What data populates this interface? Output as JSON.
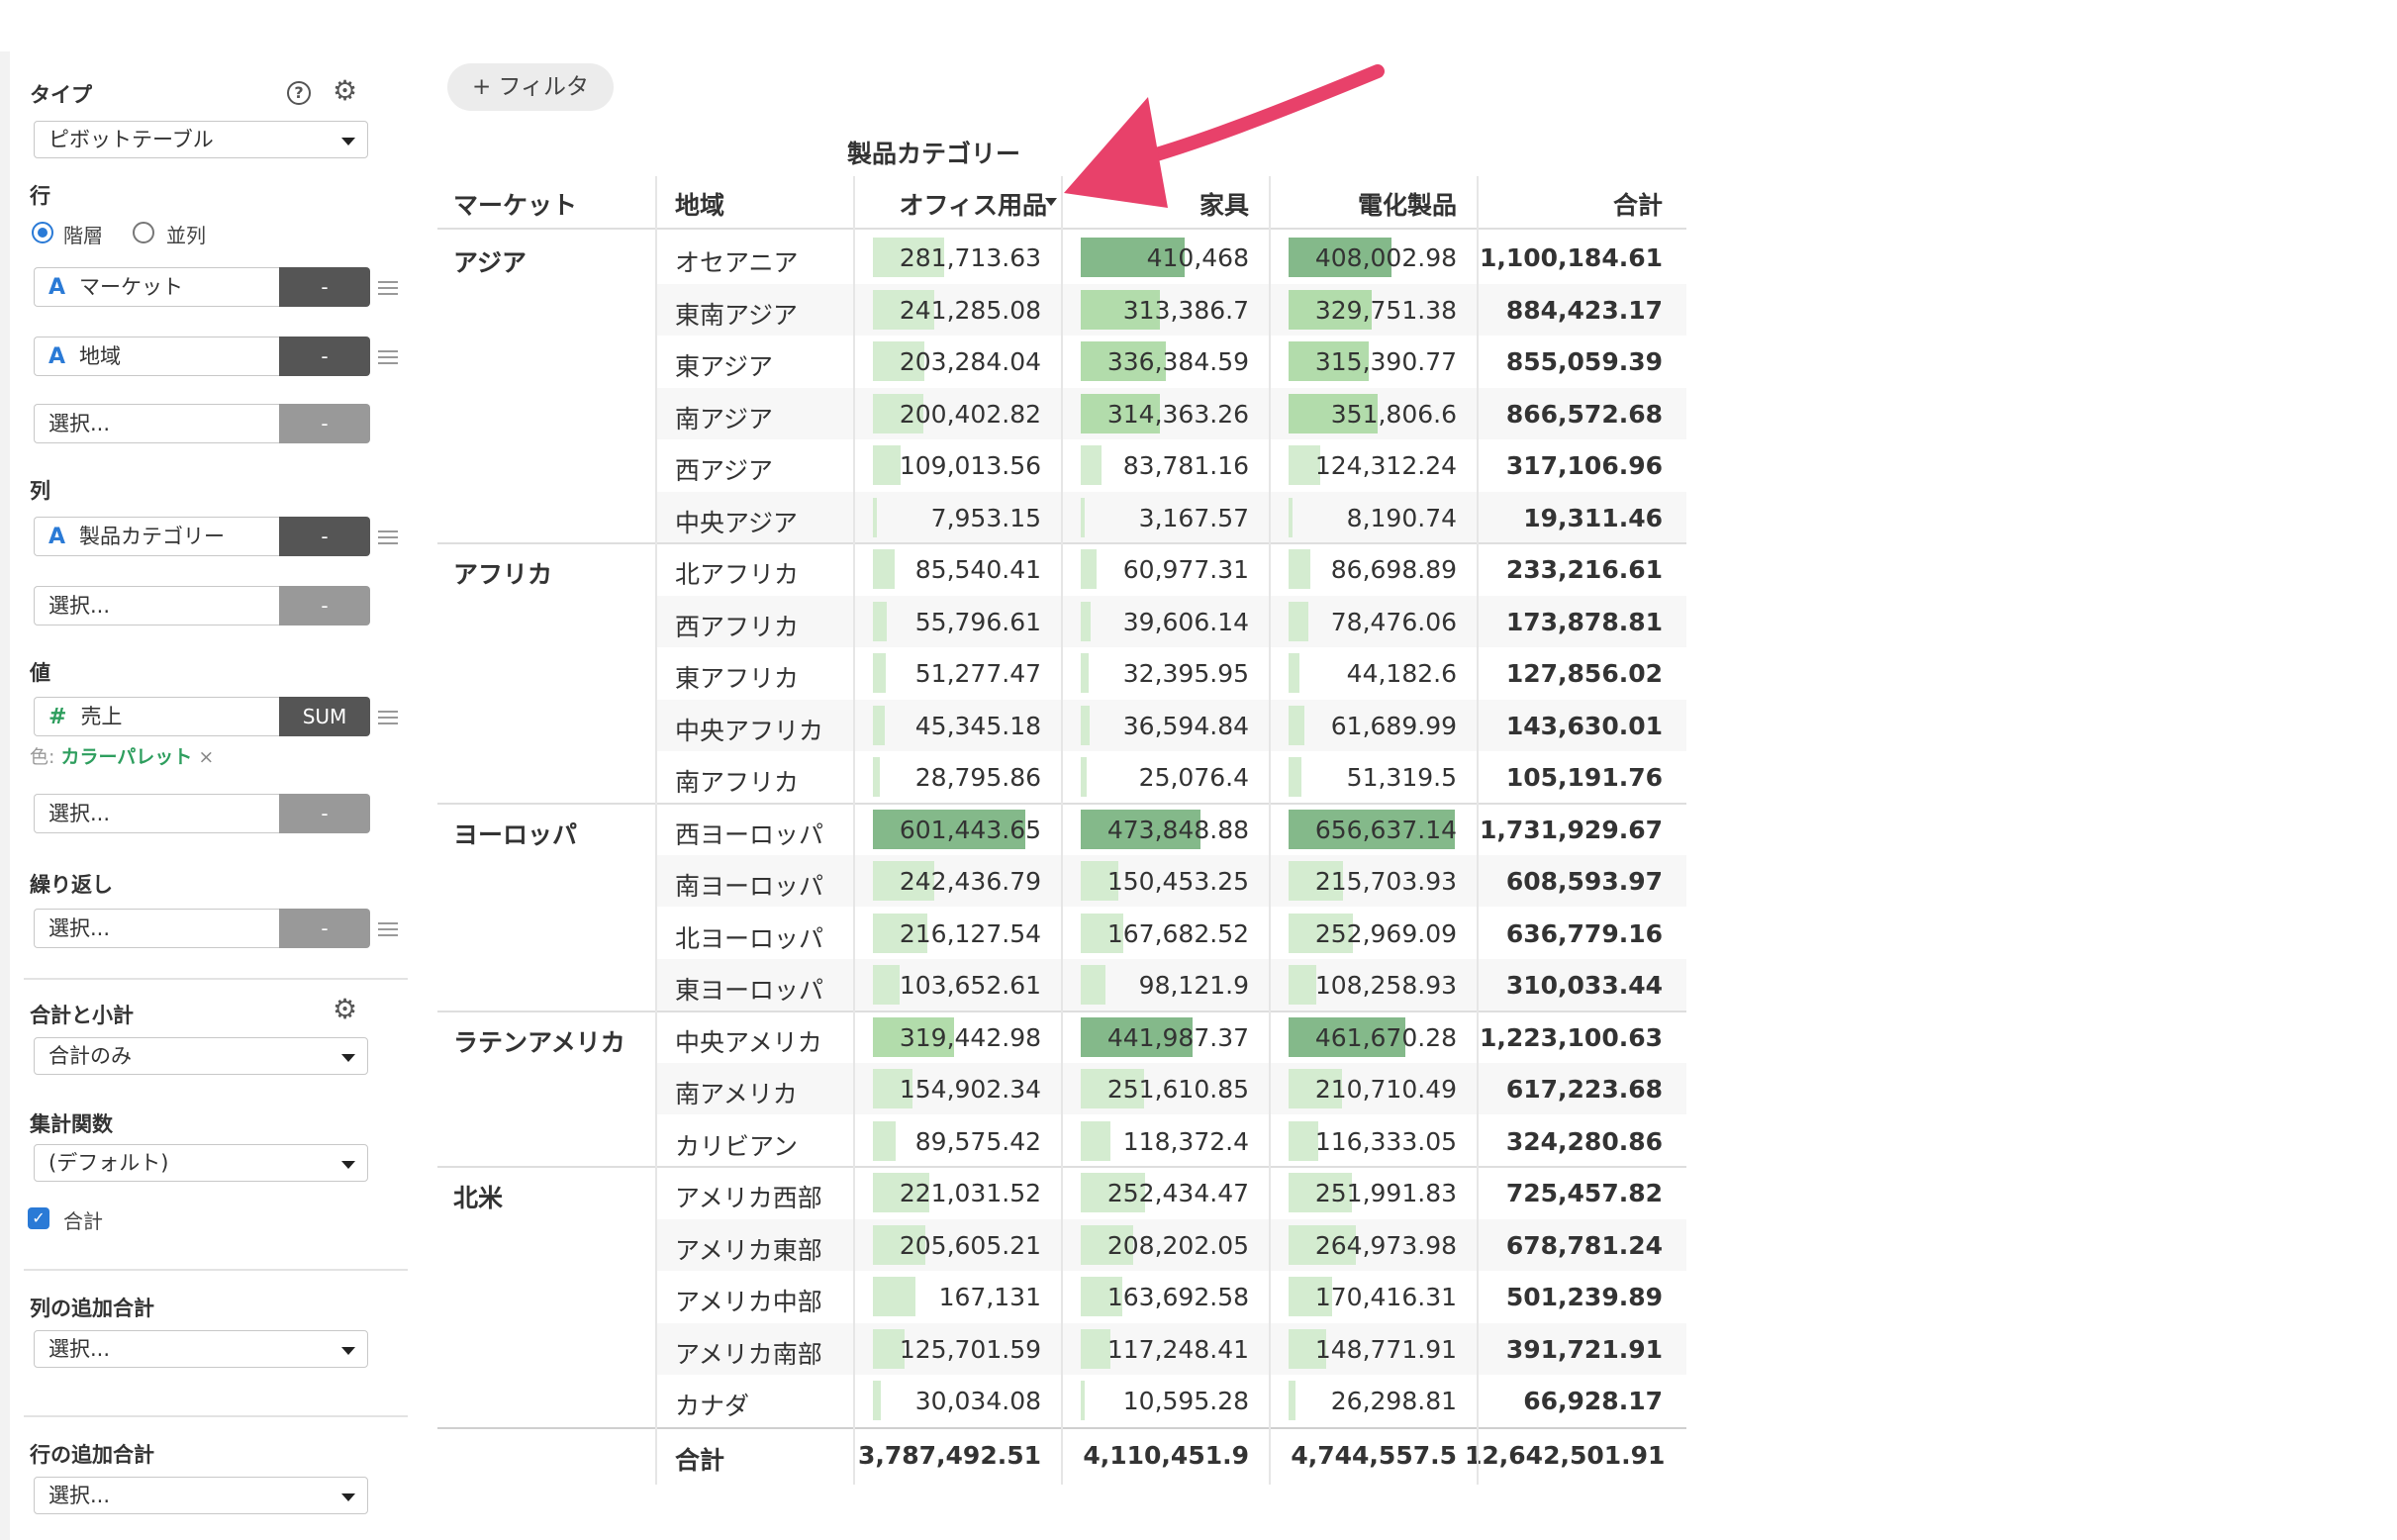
{
  "sidebar": {
    "type_label": "タイプ",
    "type_value": "ピボットテーブル",
    "rows_label": "行",
    "rows_mode_hierarchy": "階層",
    "rows_mode_parallel": "並列",
    "row_fields": [
      {
        "type_icon": "A",
        "name": "マーケット",
        "button": "-"
      },
      {
        "type_icon": "A",
        "name": "地域",
        "button": "-"
      },
      {
        "type_icon": "",
        "name": "選択...",
        "button": "-"
      }
    ],
    "columns_label": "列",
    "column_fields": [
      {
        "type_icon": "A",
        "name": "製品カテゴリー",
        "button": "-"
      },
      {
        "type_icon": "",
        "name": "選択...",
        "button": "-"
      }
    ],
    "values_label": "値",
    "value_fields": [
      {
        "type_icon": "#",
        "name": "売上",
        "button": "SUM"
      },
      {
        "type_icon": "",
        "name": "選択...",
        "button": "-"
      }
    ],
    "color_prefix": "色:",
    "color_value": "カラーパレット",
    "color_remove": "×",
    "repeat_label": "繰り返し",
    "repeat_field": {
      "name": "選択...",
      "button": "-"
    },
    "totals_label": "合計と小計",
    "totals_value": "合計のみ",
    "agg_label": "集計関数",
    "agg_value": "(デフォルト)",
    "total_checkbox_label": "合計",
    "col_extra_total_label": "列の追加合計",
    "col_extra_total_value": "選択...",
    "row_extra_total_label": "行の追加合計",
    "row_extra_total_value": "選択..."
  },
  "filter_button": "+ フィルタ",
  "pivot": {
    "column_group_title": "製品カテゴリー",
    "headers": [
      "マーケット",
      "地域",
      "オフィス用品",
      "家具",
      "電化製品",
      "合計"
    ],
    "groups": [
      {
        "market": "アジア",
        "rows": [
          {
            "region": "オセアニア",
            "values": [
              "281,713.63",
              "410,468",
              "408,002.98"
            ],
            "total": "1,100,184.61"
          },
          {
            "region": "東南アジア",
            "values": [
              "241,285.08",
              "313,386.7",
              "329,751.38"
            ],
            "total": "884,423.17"
          },
          {
            "region": "東アジア",
            "values": [
              "203,284.04",
              "336,384.59",
              "315,390.77"
            ],
            "total": "855,059.39"
          },
          {
            "region": "南アジア",
            "values": [
              "200,402.82",
              "314,363.26",
              "351,806.6"
            ],
            "total": "866,572.68"
          },
          {
            "region": "西アジア",
            "values": [
              "109,013.56",
              "83,781.16",
              "124,312.24"
            ],
            "total": "317,106.96"
          },
          {
            "region": "中央アジア",
            "values": [
              "7,953.15",
              "3,167.57",
              "8,190.74"
            ],
            "total": "19,311.46"
          }
        ]
      },
      {
        "market": "アフリカ",
        "rows": [
          {
            "region": "北アフリカ",
            "values": [
              "85,540.41",
              "60,977.31",
              "86,698.89"
            ],
            "total": "233,216.61"
          },
          {
            "region": "西アフリカ",
            "values": [
              "55,796.61",
              "39,606.14",
              "78,476.06"
            ],
            "total": "173,878.81"
          },
          {
            "region": "東アフリカ",
            "values": [
              "51,277.47",
              "32,395.95",
              "44,182.6"
            ],
            "total": "127,856.02"
          },
          {
            "region": "中央アフリカ",
            "values": [
              "45,345.18",
              "36,594.84",
              "61,689.99"
            ],
            "total": "143,630.01"
          },
          {
            "region": "南アフリカ",
            "values": [
              "28,795.86",
              "25,076.4",
              "51,319.5"
            ],
            "total": "105,191.76"
          }
        ]
      },
      {
        "market": "ヨーロッパ",
        "rows": [
          {
            "region": "西ヨーロッパ",
            "values": [
              "601,443.65",
              "473,848.88",
              "656,637.14"
            ],
            "total": "1,731,929.67"
          },
          {
            "region": "南ヨーロッパ",
            "values": [
              "242,436.79",
              "150,453.25",
              "215,703.93"
            ],
            "total": "608,593.97"
          },
          {
            "region": "北ヨーロッパ",
            "values": [
              "216,127.54",
              "167,682.52",
              "252,969.09"
            ],
            "total": "636,779.16"
          },
          {
            "region": "東ヨーロッパ",
            "values": [
              "103,652.61",
              "98,121.9",
              "108,258.93"
            ],
            "total": "310,033.44"
          }
        ]
      },
      {
        "market": "ラテンアメリカ",
        "rows": [
          {
            "region": "中央アメリカ",
            "values": [
              "319,442.98",
              "441,987.37",
              "461,670.28"
            ],
            "total": "1,223,100.63"
          },
          {
            "region": "南アメリカ",
            "values": [
              "154,902.34",
              "251,610.85",
              "210,710.49"
            ],
            "total": "617,223.68"
          },
          {
            "region": "カリビアン",
            "values": [
              "89,575.42",
              "118,372.4",
              "116,333.05"
            ],
            "total": "324,280.86"
          }
        ]
      },
      {
        "market": "北米",
        "rows": [
          {
            "region": "アメリカ西部",
            "values": [
              "221,031.52",
              "252,434.47",
              "251,991.83"
            ],
            "total": "725,457.82"
          },
          {
            "region": "アメリカ東部",
            "values": [
              "205,605.21",
              "208,202.05",
              "264,973.98"
            ],
            "total": "678,781.24"
          },
          {
            "region": "アメリカ中部",
            "values": [
              "167,131",
              "163,692.58",
              "170,416.31"
            ],
            "total": "501,239.89"
          },
          {
            "region": "アメリカ南部",
            "values": [
              "125,701.59",
              "117,248.41",
              "148,771.91"
            ],
            "total": "391,721.91"
          },
          {
            "region": "カナダ",
            "values": [
              "30,034.08",
              "10,595.28",
              "26,298.81"
            ],
            "total": "66,928.17"
          }
        ]
      }
    ],
    "grand_total_label": "合計",
    "grand_totals": [
      "3,787,492.51",
      "4,110,451.9",
      "4,744,557.5",
      "12,642,501.91"
    ],
    "bar_max_value": 656637.14
  },
  "colors": {
    "bar_light": "#d4ecd0",
    "bar_mid": "#b2dcab",
    "bar_dark": "#84b98a",
    "arrow": "#e8416a",
    "accent": "#2a7ad6",
    "palette_link": "#2e9e5e"
  },
  "icons": {
    "help": "question-circle-icon",
    "settings": "gear-icon",
    "sort": "caret-down-icon"
  }
}
